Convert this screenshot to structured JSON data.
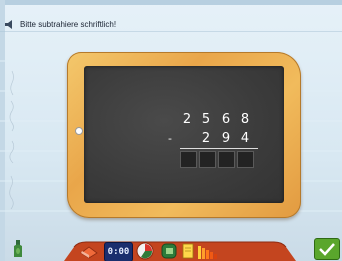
{
  "instruction": {
    "icon": "speaker-icon",
    "text": "Bitte subtrahiere schriftlich!"
  },
  "task": {
    "minuend_digits": [
      "2",
      "5",
      "6",
      "8"
    ],
    "operator": "-",
    "subtrahend_digits": [
      "2",
      "9",
      "4"
    ],
    "answer_boxes": 4
  },
  "toolbar": {
    "items": [
      "bottle-icon",
      "eraser-icon",
      "clock-icon",
      "chart-icon",
      "notebook-icon",
      "page-icon",
      "bars-icon",
      "check-icon"
    ],
    "clock_text": "0:00"
  },
  "colors": {
    "frame_wood": "#eba64a",
    "slate": "#3c3c3c",
    "chalk": "#ffffff",
    "check_green": "#5aa62c"
  }
}
